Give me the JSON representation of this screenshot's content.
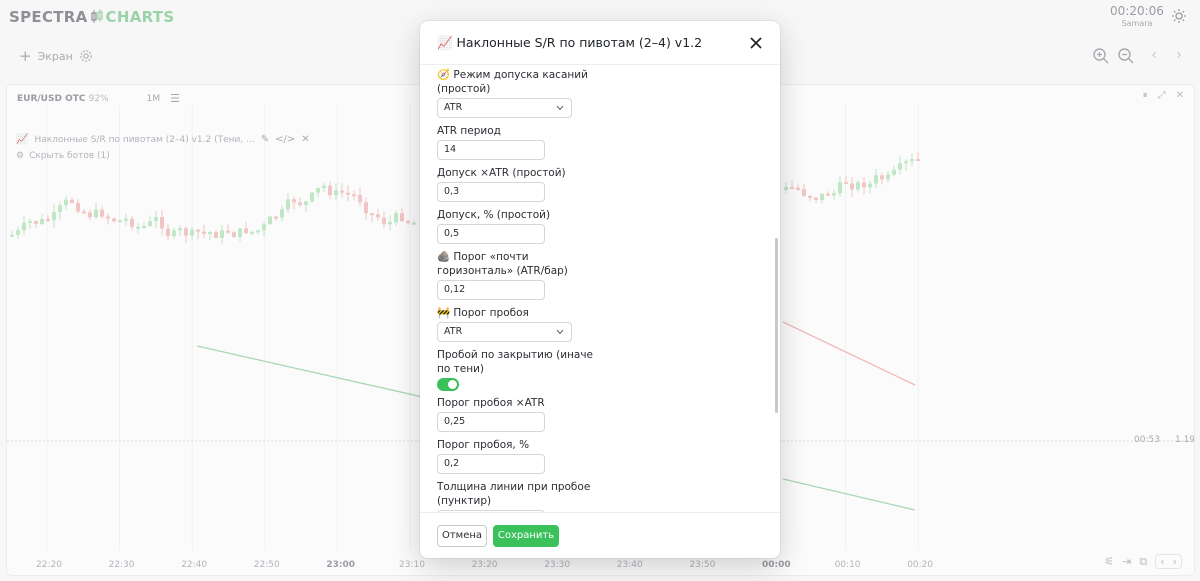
{
  "app": {
    "logo_left": "SPECTRA",
    "logo_right": "CHARTS",
    "clock": "00:20:06",
    "timezone": "Samara",
    "screen_button": "Экран"
  },
  "chart_panel": {
    "symbol": "EUR/USD OTC",
    "payout": "92%",
    "timeframe": "1M",
    "indicator_text": "Наклонные S/R по пивотам (2–4) v1.2 (Тени, ...",
    "hide_bots": "Скрыть ботов (1)",
    "countdown": "00:53",
    "price_label": "1.19",
    "time_axis": [
      "22:20",
      "22:30",
      "22:40",
      "22:50",
      "23:00",
      "23:10",
      "23:20",
      "23:30",
      "23:40",
      "23:50",
      "00:00",
      "00:10",
      "00:20"
    ],
    "bold_times": [
      "23:00",
      "00:00"
    ],
    "colors": {
      "up": "#bfe6c5",
      "down": "#f2c5c5",
      "support": "#a9d6b2",
      "resistance": "#f1b8b8"
    }
  },
  "modal": {
    "title": "📈 Наклонные S/R по пивотам (2–4) v1.2",
    "fields": {
      "touch_mode_label": "🧭 Режим допуска касаний (простой)",
      "touch_mode_value": "ATR",
      "atr_period_label": "ATR период",
      "atr_period_value": "14",
      "tol_atr_label": "Допуск ×ATR (простой)",
      "tol_atr_value": "0,3",
      "tol_pct_label": "Допуск, % (простой)",
      "tol_pct_value": "0,5",
      "near_horiz_label": "🪨 Порог «почти горизонталь» (ATR/бар)",
      "near_horiz_value": "0,12",
      "breakout_label": "🚧 Порог пробоя",
      "breakout_value": "ATR",
      "close_break_label": "Пробой по закрытию (иначе по тени)",
      "close_break_on": true,
      "break_atr_label": "Порог пробоя ×ATR",
      "break_atr_value": "0,25",
      "break_pct_label": "Порог пробоя, %",
      "break_pct_value": "0,2",
      "line_width_label": "Толщина линии при пробое (пунктир)"
    },
    "cancel_label": "Отмена",
    "save_label": "Сохранить",
    "accent": "#3ac15b"
  }
}
